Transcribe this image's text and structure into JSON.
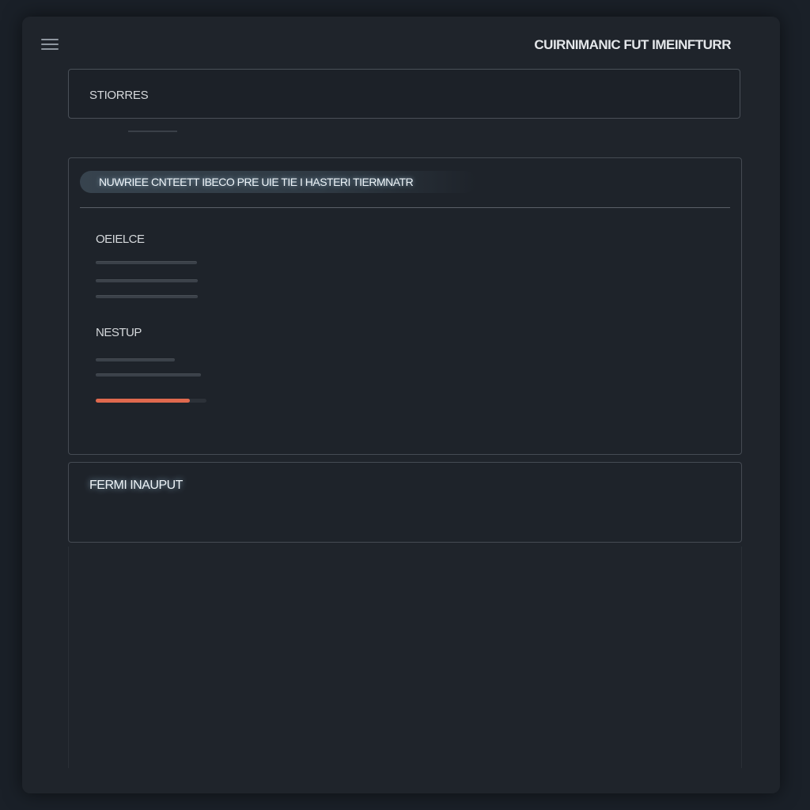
{
  "header": {
    "title": "CUIRNIMANIC FUT IMEINFTURR",
    "menu_icon": "hamburger-menu-icon"
  },
  "search": {
    "label": "STIORRES"
  },
  "main_panel": {
    "title": "NUWRIEE CNTEETT IBECO PRE UIE TIE I HASTERI TIERMNATR",
    "section1": {
      "label": "OEIELCE"
    },
    "section2": {
      "label": "NESTUP",
      "progress": 0.85,
      "progress_color": "#e0694e"
    }
  },
  "input_panel": {
    "label": "FERMI INAUPUT"
  }
}
